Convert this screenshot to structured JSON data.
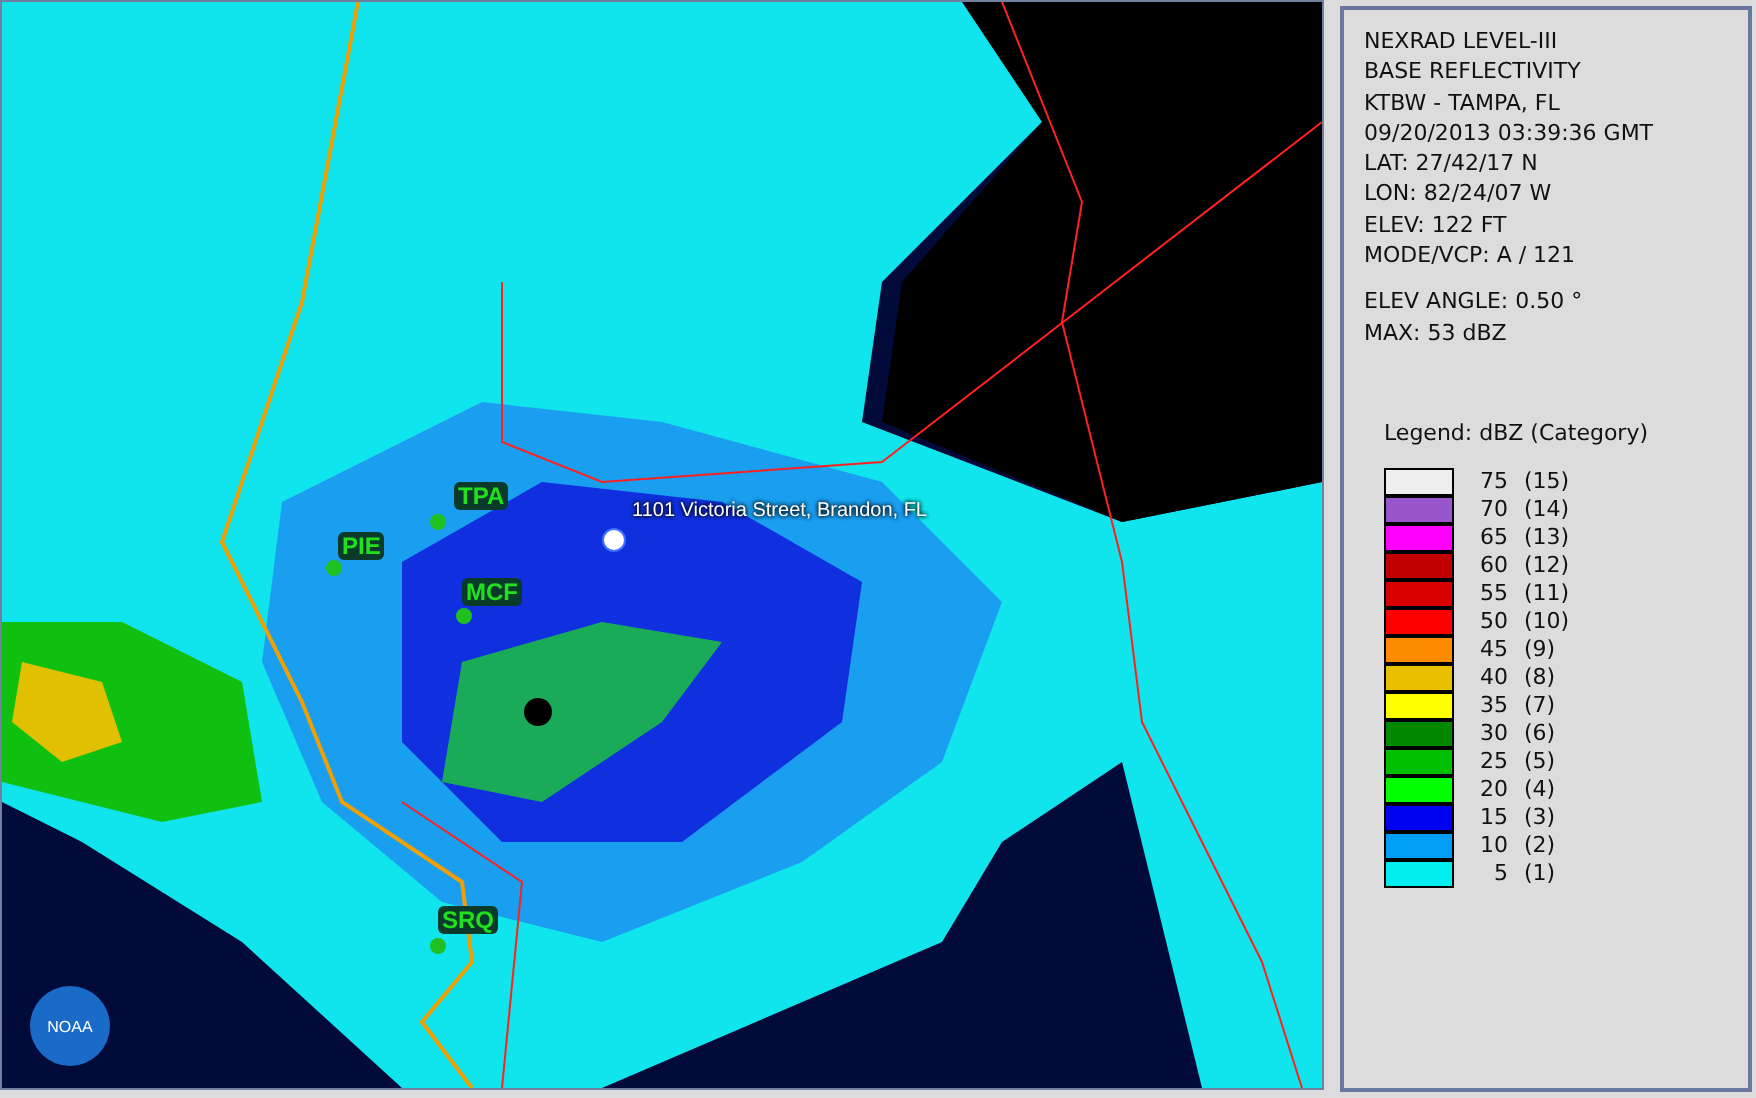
{
  "map": {
    "stations": [
      {
        "code": "TPA"
      },
      {
        "code": "PIE"
      },
      {
        "code": "MCF"
      },
      {
        "code": "SRQ"
      }
    ],
    "marker_label": "1101 Victoria Street, Brandon, FL",
    "logo_text": "NOAA"
  },
  "info": {
    "lines": [
      "NEXRAD LEVEL-III",
      "BASE REFLECTIVITY",
      "KTBW - TAMPA, FL",
      "09/20/2013 03:39:36 GMT",
      "LAT: 27/42/17 N",
      "LON: 82/24/07 W",
      "ELEV: 122 FT",
      "MODE/VCP: A / 121"
    ],
    "extra_lines": [
      "ELEV ANGLE: 0.50 °",
      "MAX: 53 dBZ"
    ]
  },
  "legend": {
    "title": "Legend: dBZ (Category)",
    "items": [
      {
        "value": "75",
        "category": "(15)",
        "color": "#eeeeee"
      },
      {
        "value": "70",
        "category": "(14)",
        "color": "#9955cc"
      },
      {
        "value": "65",
        "category": "(13)",
        "color": "#ff00ff"
      },
      {
        "value": "60",
        "category": "(12)",
        "color": "#c00000"
      },
      {
        "value": "55",
        "category": "(11)",
        "color": "#d80000"
      },
      {
        "value": "50",
        "category": "(10)",
        "color": "#ff0000"
      },
      {
        "value": "45",
        "category": "(9)",
        "color": "#ff8c00"
      },
      {
        "value": "40",
        "category": "(8)",
        "color": "#e8c000"
      },
      {
        "value": "35",
        "category": "(7)",
        "color": "#ffff00"
      },
      {
        "value": "30",
        "category": "(6)",
        "color": "#008800"
      },
      {
        "value": "25",
        "category": "(5)",
        "color": "#00c000"
      },
      {
        "value": "20",
        "category": "(4)",
        "color": "#00ff00"
      },
      {
        "value": "15",
        "category": "(3)",
        "color": "#0000f0"
      },
      {
        "value": "10",
        "category": "(2)",
        "color": "#009ef5"
      },
      {
        "value": "5",
        "category": "(1)",
        "color": "#00eef0"
      }
    ]
  }
}
